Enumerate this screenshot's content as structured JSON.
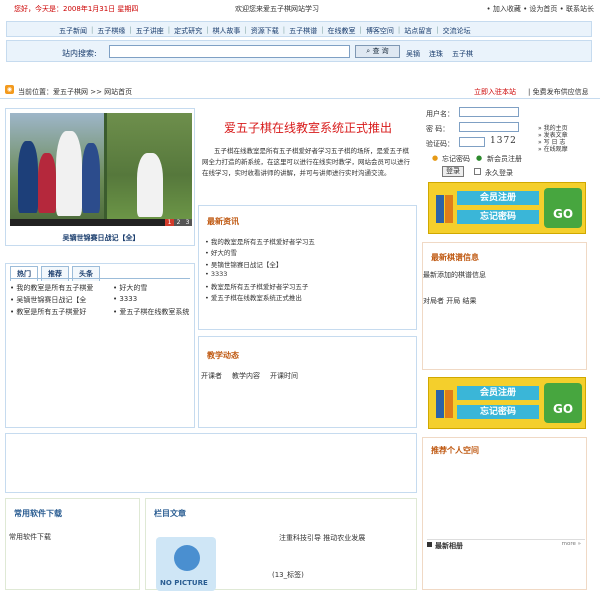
{
  "topbar": {
    "greeting": "您好，今天是：2008年1月31日 星期四",
    "welcome": "欢迎您来爱五子棋网站学习",
    "links": "• 加入收藏 • 设为首页 • 联系站长"
  },
  "nav": {
    "items": [
      "五子新闻",
      "五子棋缘",
      "五子讲座",
      "定式研究",
      "棋人故事",
      "资源下载",
      "五子棋谱",
      "在线教室",
      "博客空间",
      "站点留言",
      "交流论坛"
    ]
  },
  "search": {
    "label": "站内搜索:",
    "button": "查 询",
    "hot": [
      "吴镝",
      "连珠",
      "五子棋"
    ],
    "placeholder": ""
  },
  "crumb": {
    "text": "当前位置：爱五子棋网 >> 网站首页",
    "link1": "立即入驻本站",
    "link2": "| 免费发布供应信息"
  },
  "photo": {
    "caption": "吴镝世锦赛日战记【全】",
    "nums": [
      "1",
      "2",
      "3"
    ]
  },
  "tabs": {
    "items": [
      "热门",
      "推荐",
      "头条"
    ]
  },
  "list2": [
    [
      "• 我的教室是所有五子棋爱",
      "• 好大的雪"
    ],
    [
      "• 吴镝世锦赛日战记【全",
      "• 3333"
    ],
    [
      "• 教室是所有五子棋爱好",
      "• 爱五子棋在线教室系统"
    ]
  ],
  "announce": {
    "title": "爱五子棋在线教室系统正式推出",
    "body": "五子棋在线教室是所有五子棋爱好者学习五子棋的场所，是爱五子棋网全力打造的新系统，在这里可以进行在线实时教学，网站会员可以进行在线学习，实时收看讲师的讲解，并可与讲师进行实时沟通交流。"
  },
  "news": {
    "title": "最新资讯",
    "items": [
      "• 我的教室是所有五子棋爱好者学习五",
      "• 好大的雪",
      "• 吴镝世锦赛日战记【全】",
      "• 3333",
      "• 教室是所有五子棋爱好者学习五子",
      "• 爱五子棋在线教室系统正式推出"
    ]
  },
  "edu": {
    "title": "教学动态",
    "links": [
      "开课者",
      "教学内容",
      "开课时间"
    ]
  },
  "login": {
    "user_label": "用户名：",
    "pass_label": "密   码：",
    "code_label": "验证码：",
    "captcha": "1372",
    "side": [
      "» 我的主页",
      "» 发表文章",
      "» 写 日 志",
      "» 在线观摩"
    ],
    "forgot": "忘记密码",
    "register": "新会员注册",
    "submit": "登录",
    "remember": "永久登录"
  },
  "banner": {
    "register": "会员注册",
    "forgot": "忘记密码",
    "go": "GO"
  },
  "chess": {
    "title": "最新棋谱信息",
    "line1": "最新添加的棋谱信息",
    "line2": "对局者  开局  结果"
  },
  "space": {
    "title": "推荐个人空间",
    "album": "最新相册",
    "more": "more »"
  },
  "soft": {
    "title": "常用软件下载",
    "item": "常用软件下载"
  },
  "column": {
    "title": "栏目文章",
    "item1": "注重科技引导  推动农业发展",
    "item2": "(13_标签)",
    "noimg": "NO PICTURE"
  }
}
